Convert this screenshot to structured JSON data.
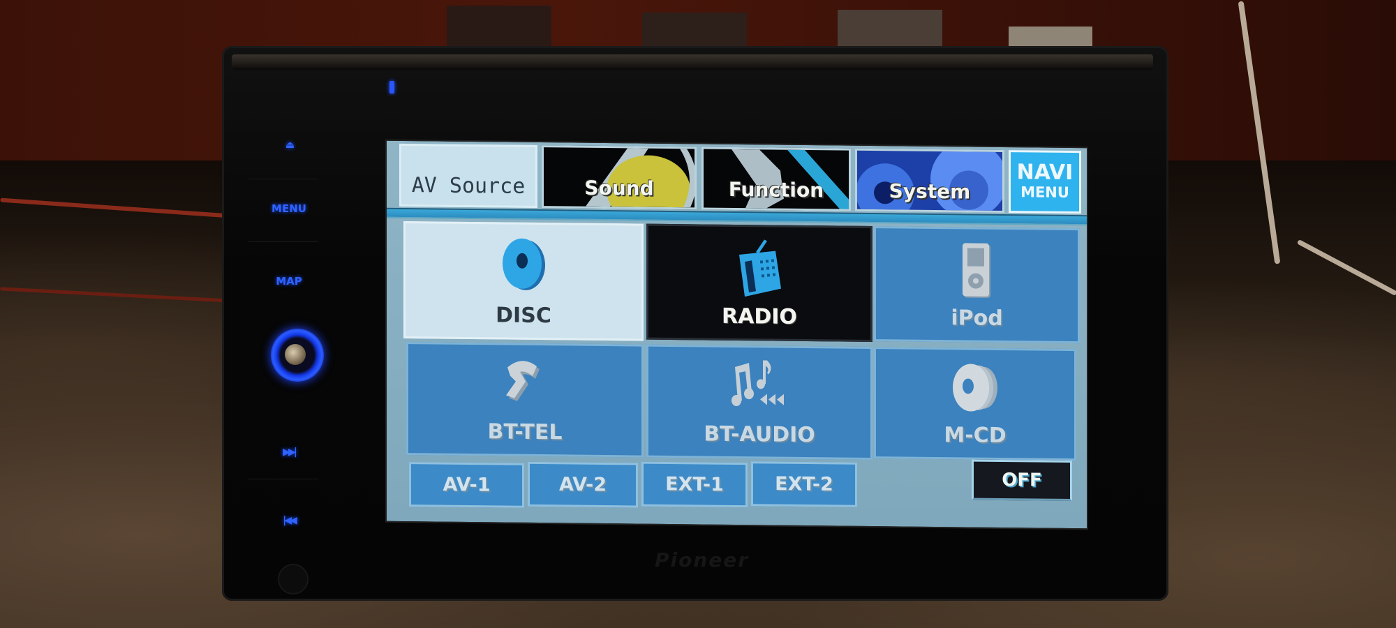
{
  "device": {
    "brand": "Pioneer",
    "hardware_buttons": [
      {
        "id": "eject",
        "glyph": "⏏"
      },
      {
        "id": "menu",
        "label": "MENU"
      },
      {
        "id": "map",
        "label": "MAP"
      },
      {
        "id": "next",
        "glyph": "▶▶|"
      },
      {
        "id": "prev",
        "glyph": "|◀◀"
      }
    ],
    "led_color": "#2f63ff"
  },
  "tabs": [
    {
      "label": "AV Source",
      "active": true
    },
    {
      "label": "Sound",
      "active": false
    },
    {
      "label": "Function",
      "active": false
    },
    {
      "label": "System",
      "active": false
    }
  ],
  "navi_menu": {
    "line1": "NAVI",
    "line2": "MENU",
    "color": "#2fb3ee"
  },
  "sources": [
    {
      "label": "DISC",
      "icon": "disc-icon",
      "state": "selected"
    },
    {
      "label": "RADIO",
      "icon": "radio-icon",
      "state": "highlighted"
    },
    {
      "label": "iPod",
      "icon": "ipod-icon",
      "state": "normal"
    },
    {
      "label": "BT-TEL",
      "icon": "bluetooth-phone-icon",
      "state": "normal"
    },
    {
      "label": "BT-AUDIO",
      "icon": "bluetooth-audio-icon",
      "state": "normal"
    },
    {
      "label": "M-CD",
      "icon": "multi-cd-icon",
      "state": "normal"
    }
  ],
  "inputs": [
    "AV-1",
    "AV-2",
    "EXT-1",
    "EXT-2"
  ],
  "off_button": "OFF",
  "colors": {
    "screen_bg": "#8fb5c6",
    "button_blue": "#3b82be",
    "accent_cyan": "#2fb3ee"
  }
}
